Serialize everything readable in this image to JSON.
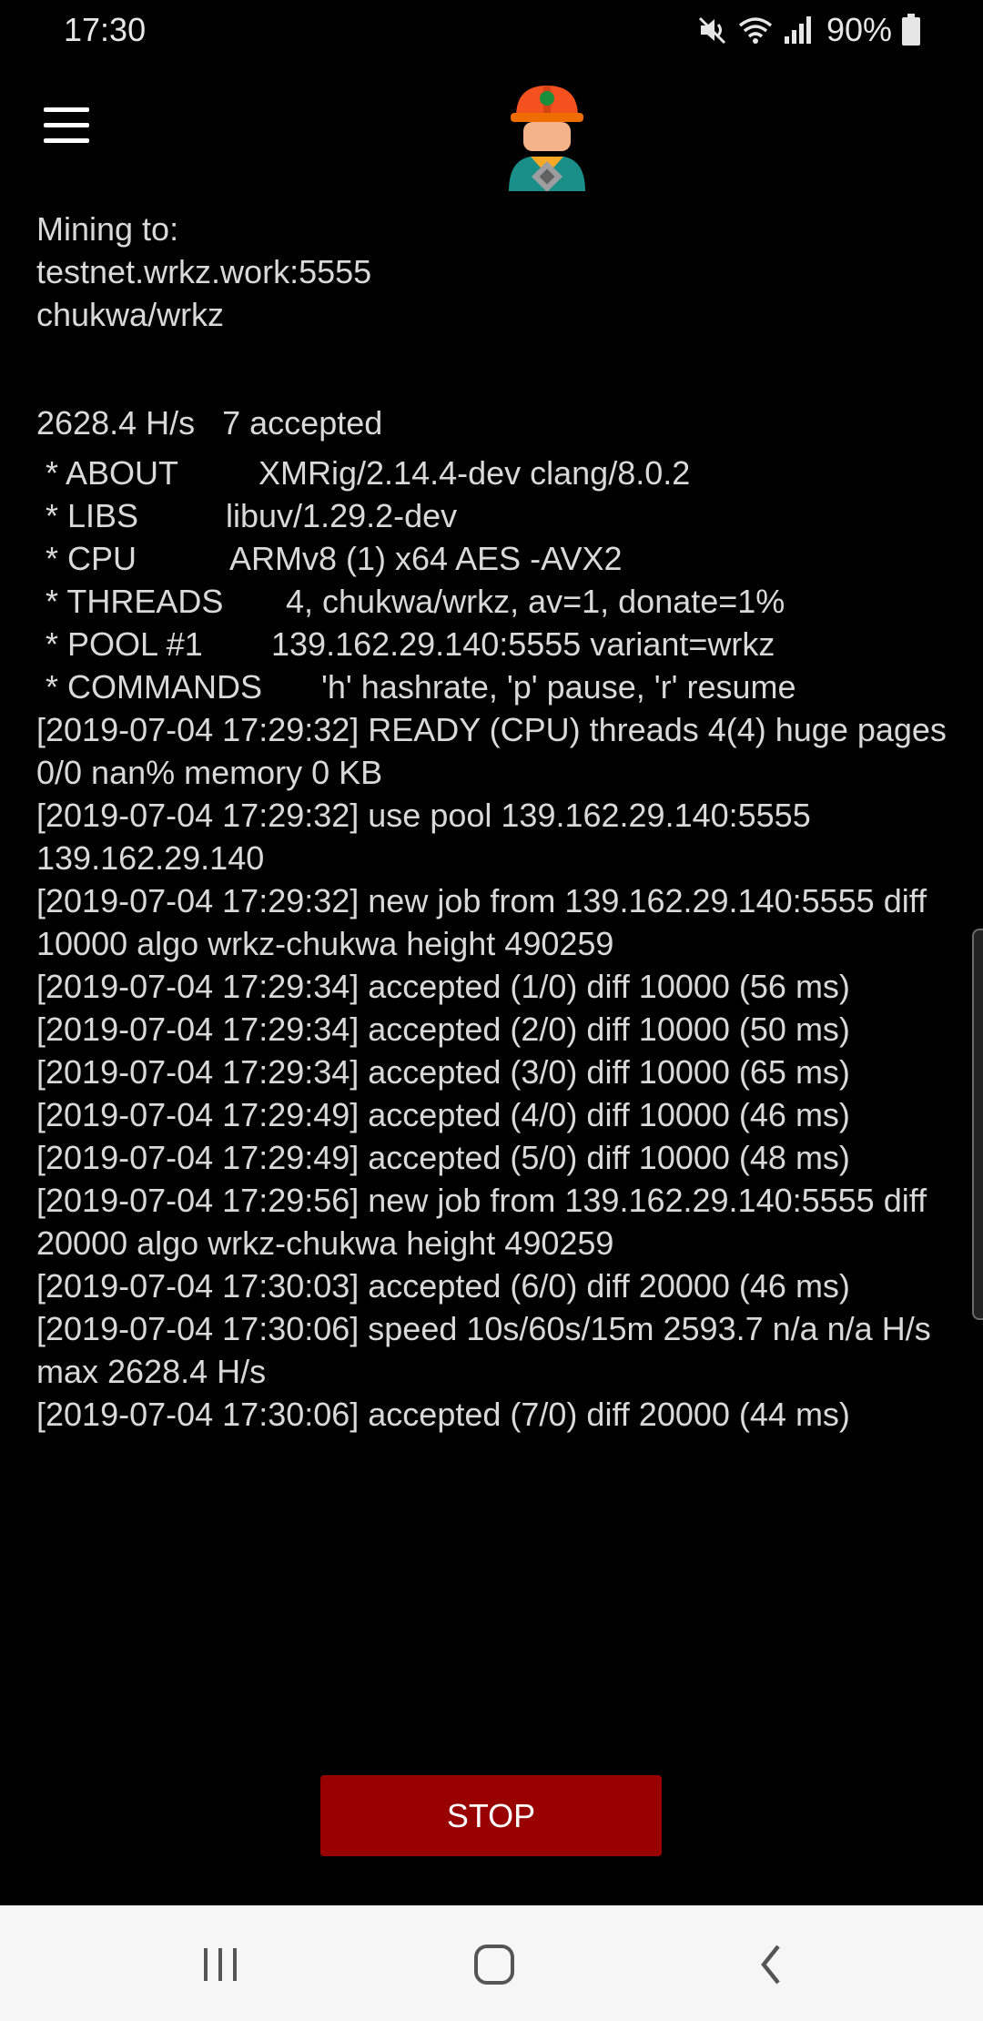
{
  "status_bar": {
    "time": "17:30",
    "battery": "90%",
    "icons": [
      "mute-icon",
      "wifi-icon",
      "signal-icon",
      "battery-icon"
    ]
  },
  "app_bar": {
    "menu_icon": "hamburger-menu-icon",
    "logo_icon": "miner-worker-icon"
  },
  "mining": {
    "label": "Mining to:",
    "pool": "testnet.wrkz.work:5555",
    "algo": "chukwa/wrkz"
  },
  "stats": {
    "hashrate": "2628.4 H/s",
    "accepted": "7 accepted"
  },
  "info": [
    {
      "key": " * ABOUT",
      "value": "XMRig/2.14.4-dev clang/8.0.2"
    },
    {
      "key": " * LIBS",
      "value": "libuv/1.29.2-dev"
    },
    {
      "key": " * CPU",
      "value": "ARMv8 (1) x64 AES -AVX2"
    },
    {
      "key": " * THREADS",
      "value": "4, chukwa/wrkz, av=1, donate=1%"
    },
    {
      "key": " * POOL #1",
      "value": "139.162.29.140:5555 variant=wrkz"
    },
    {
      "key": " * COMMANDS",
      "value": "'h' hashrate, 'p' pause, 'r' resume"
    }
  ],
  "log": [
    "[2019-07-04 17:29:32] READY (CPU) threads 4(4) huge pages 0/0 nan% memory 0 KB",
    "[2019-07-04 17:29:32] use pool 139.162.29.140:5555 139.162.29.140",
    "[2019-07-04 17:29:32] new job from 139.162.29.140:5555 diff 10000 algo wrkz-chukwa height 490259",
    "[2019-07-04 17:29:34] accepted (1/0) diff 10000 (56 ms)",
    "[2019-07-04 17:29:34] accepted (2/0) diff 10000 (50 ms)",
    "[2019-07-04 17:29:34] accepted (3/0) diff 10000 (65 ms)",
    "[2019-07-04 17:29:49] accepted (4/0) diff 10000 (46 ms)",
    "[2019-07-04 17:29:49] accepted (5/0) diff 10000 (48 ms)",
    "[2019-07-04 17:29:56] new job from 139.162.29.140:5555 diff 20000 algo wrkz-chukwa height 490259",
    "[2019-07-04 17:30:03] accepted (6/0) diff 20000 (46 ms)",
    "[2019-07-04 17:30:06] speed 10s/60s/15m 2593.7 n/a n/a H/s max 2628.4 H/s",
    "[2019-07-04 17:30:06] accepted (7/0) diff 20000 (44 ms)"
  ],
  "stop_button": {
    "label": "STOP",
    "color": "#990000"
  },
  "nav_bar": {
    "icons": [
      "recent-apps-icon",
      "home-icon",
      "back-icon"
    ]
  }
}
